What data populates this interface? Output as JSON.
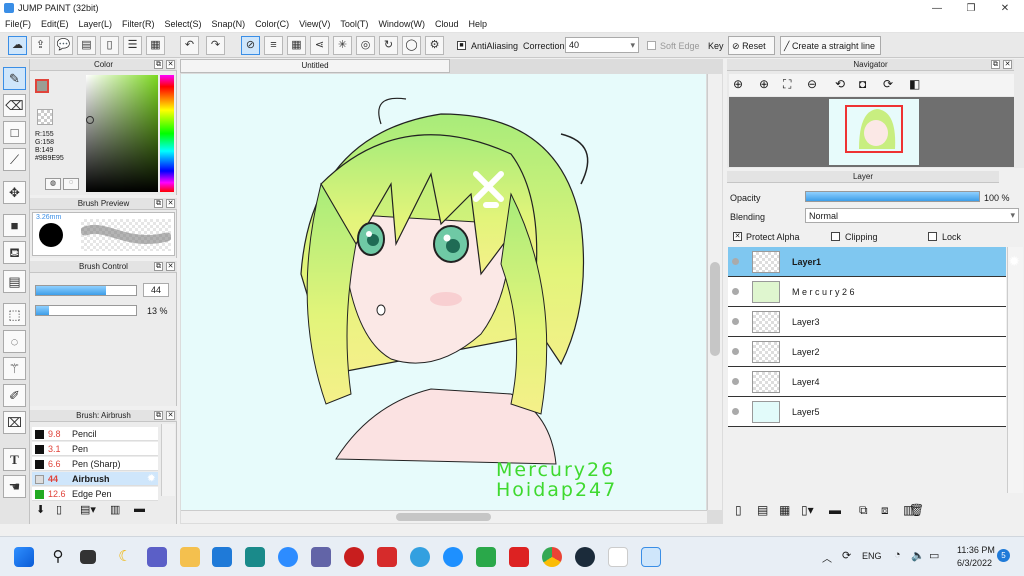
{
  "window": {
    "title": "JUMP PAINT (32bit)"
  },
  "menu": [
    "File(F)",
    "Edit(E)",
    "Layer(L)",
    "Filter(R)",
    "Select(S)",
    "Snap(N)",
    "Color(C)",
    "View(V)",
    "Tool(T)",
    "Window(W)",
    "Cloud",
    "Help"
  ],
  "toolbar": {
    "antialiasing": "AntiAliasing",
    "correction_label": "Correction",
    "correction_value": "40",
    "soft_edge": "Soft Edge",
    "key_label": "Key",
    "reset": "Reset",
    "straight_line": "Create a straight line"
  },
  "color_panel": {
    "title": "Color",
    "r": "R:155",
    "g": "G:158",
    "b": "B:149",
    "hex": "#9B9E95",
    "current_color": "#9b9e95"
  },
  "brush_preview": {
    "title": "Brush Preview",
    "size": "3.26mm"
  },
  "brush_control": {
    "title": "Brush Control",
    "size_value": "44",
    "opacity_value": "13 %",
    "size_fill": 0.7,
    "opacity_fill": 0.13
  },
  "brush_list": {
    "title": "Brush: Airbrush",
    "items": [
      {
        "size": "9.8",
        "name": "Pencil",
        "color": "#111111"
      },
      {
        "size": "3.1",
        "name": "Pen",
        "color": "#111111"
      },
      {
        "size": "6.6",
        "name": "Pen (Sharp)",
        "color": "#111111"
      },
      {
        "size": "44",
        "name": "Airbrush",
        "color": "#dddddd"
      },
      {
        "size": "12.6",
        "name": "Edge Pen",
        "color": "#22aa22"
      }
    ]
  },
  "canvas": {
    "tab": "Untitled",
    "sign1": "Mercury26",
    "sign2": "Hoidap247"
  },
  "navigator": {
    "title": "Navigator"
  },
  "layer_panel": {
    "title": "Layer",
    "opacity_label": "Opacity",
    "opacity_value": "100 %",
    "blending_label": "Blending",
    "blending_value": "Normal",
    "protect_alpha": "Protect Alpha",
    "clipping": "Clipping",
    "lock": "Lock",
    "layers": [
      "Layer1",
      "M e r c u r y 2 6",
      "Layer3",
      "Layer2",
      "Layer4",
      "Layer5"
    ]
  },
  "taskbar": {
    "lang": "ENG",
    "time": "11:36 PM",
    "date": "6/3/2022",
    "badge": "5"
  }
}
